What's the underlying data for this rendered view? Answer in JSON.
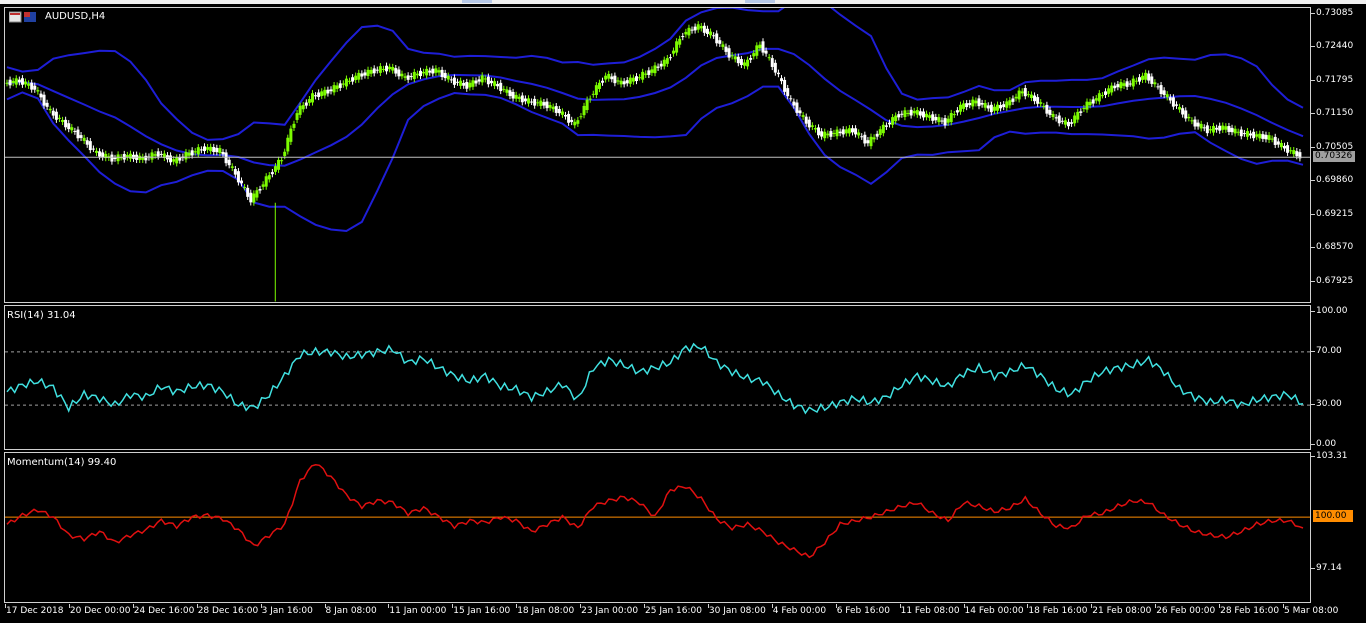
{
  "main": {
    "symbol_label": "AUDUSD,H4",
    "current_price": "0.70326",
    "y_ticks": [
      "0.73085",
      "0.72440",
      "0.71795",
      "0.71150",
      "0.70505",
      "0.69860",
      "0.69215",
      "0.68570",
      "0.67925"
    ]
  },
  "rsi": {
    "label": "RSI(14) 31.04",
    "y_ticks": [
      "100.00",
      "70.00",
      "30.00",
      "0.00"
    ]
  },
  "momentum": {
    "label": "Momentum(14) 99.40",
    "y_ticks": [
      "103.31",
      "97.14"
    ],
    "level_value": "100.00"
  },
  "x_ticks": [
    "17 Dec 2018",
    "20 Dec 00:00",
    "24 Dec 16:00",
    "28 Dec 16:00",
    "3 Jan 16:00",
    "8 Jan 08:00",
    "11 Jan 00:00",
    "15 Jan 16:00",
    "18 Jan 08:00",
    "23 Jan 00:00",
    "25 Jan 16:00",
    "30 Jan 08:00",
    "4 Feb 00:00",
    "6 Feb 16:00",
    "11 Feb 08:00",
    "14 Feb 00:00",
    "18 Feb 16:00",
    "21 Feb 08:00",
    "26 Feb 00:00",
    "28 Feb 16:00",
    "5 Mar 08:00"
  ],
  "colors": {
    "background": "#000000",
    "candle_up": "#7CFC00",
    "candle_down": "#ffffff",
    "bollinger": "#1e1ed7",
    "rsi_line": "#40e0e0",
    "momentum_line": "#e01010",
    "momentum_level": "#ff8c00",
    "grid_frame": "#d0d0d0"
  },
  "chart_data": [
    {
      "type": "line",
      "title": "AUDUSD,H4",
      "series": [
        {
          "name": "",
          "values": [
            0.7175,
            0.718,
            0.7165,
            0.712,
            0.7095,
            0.707,
            0.704,
            0.703,
            0.7035,
            0.703,
            0.704,
            0.7025,
            0.704,
            0.705,
            0.7045,
            0.7,
            0.695,
            0.699,
            0.703,
            0.712,
            0.715,
            0.716,
            0.7175,
            0.719,
            0.72,
            0.7205,
            0.7185,
            0.7195,
            0.72,
            0.718,
            0.717,
            0.7185,
            0.717,
            0.715,
            0.714,
            0.7135,
            0.712,
            0.7095,
            0.715,
            0.719,
            0.7175,
            0.7185,
            0.72,
            0.722,
            0.727,
            0.7285,
            0.7265,
            0.723,
            0.721,
            0.725,
            0.72,
            0.714,
            0.71,
            0.7075,
            0.708,
            0.7085,
            0.706,
            0.709,
            0.7115,
            0.712,
            0.711,
            0.71,
            0.713,
            0.714,
            0.7125,
            0.7135,
            0.716,
            0.714,
            0.711,
            0.7095,
            0.713,
            0.715,
            0.717,
            0.7175,
            0.719,
            0.716,
            0.713,
            0.71,
            0.7085,
            0.709,
            0.708,
            0.7075,
            0.707,
            0.705,
            0.7035
          ]
        }
      ],
      "ylim": [
        0.675,
        0.732
      ]
    },
    {
      "type": "line",
      "title": "RSI(14) 31.04",
      "series": [
        {
          "name": "",
          "values": [
            40,
            45,
            48,
            43,
            28,
            38,
            35,
            30,
            38,
            36,
            44,
            40,
            44,
            45,
            40,
            30,
            28,
            38,
            52,
            68,
            70,
            70,
            66,
            68,
            70,
            72,
            62,
            65,
            58,
            52,
            48,
            52,
            44,
            42,
            36,
            40,
            46,
            34,
            58,
            64,
            60,
            55,
            58,
            62,
            73,
            74,
            62,
            55,
            50,
            48,
            38,
            30,
            26,
            28,
            32,
            35,
            32,
            36,
            45,
            52,
            48,
            44,
            54,
            58,
            52,
            55,
            60,
            52,
            42,
            38,
            48,
            55,
            58,
            60,
            64,
            55,
            42,
            36,
            32,
            34,
            30,
            34,
            36,
            38,
            31
          ]
        }
      ],
      "ylim": [
        0,
        100
      ]
    },
    {
      "type": "line",
      "title": "Momentum(14) 99.40",
      "series": [
        {
          "name": "",
          "values": [
            99.6,
            100.1,
            100.4,
            100.0,
            99.0,
            98.8,
            99.2,
            98.6,
            99.0,
            99.3,
            99.8,
            99.5,
            100.0,
            100.1,
            99.9,
            99.3,
            98.4,
            99.0,
            99.6,
            102.0,
            103.0,
            102.2,
            101.2,
            100.6,
            100.9,
            100.8,
            100.2,
            100.5,
            100.0,
            99.5,
            99.8,
            99.7,
            100.0,
            99.8,
            99.2,
            99.6,
            100.0,
            99.4,
            100.6,
            100.9,
            101.1,
            100.8,
            100.0,
            101.5,
            101.7,
            101.0,
            99.9,
            99.4,
            99.6,
            99.2,
            98.6,
            98.2,
            97.8,
            98.6,
            99.6,
            99.8,
            100.0,
            100.3,
            100.6,
            100.8,
            100.2,
            99.8,
            100.8,
            100.6,
            100.3,
            100.5,
            101.0,
            100.2,
            99.5,
            99.4,
            100.1,
            100.2,
            100.6,
            100.9,
            100.8,
            100.1,
            99.6,
            99.2,
            99.0,
            98.9,
            99.2,
            99.6,
            99.8,
            99.8,
            99.4
          ]
        }
      ],
      "ylim": [
        97.14,
        103.31
      ]
    }
  ]
}
